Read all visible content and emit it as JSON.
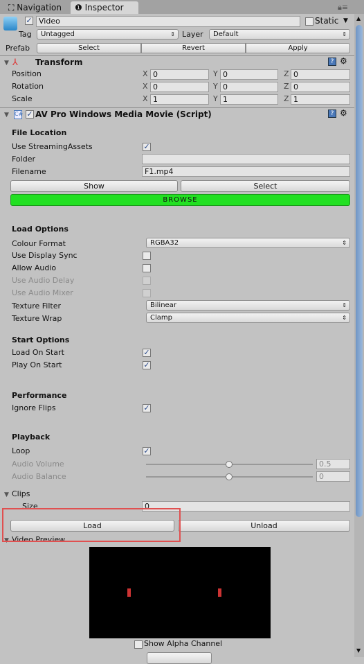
{
  "tabs": [
    {
      "label": "Navigation",
      "icon": "navigation-icon"
    },
    {
      "label": "Inspector",
      "icon": "info-icon"
    }
  ],
  "object": {
    "name": "Video",
    "active": true,
    "static_label": "Static",
    "static": false,
    "tag_label": "Tag",
    "tag": "Untagged",
    "layer_label": "Layer",
    "layer": "Default",
    "prefab_label": "Prefab",
    "prefab_buttons": [
      "Select",
      "Revert",
      "Apply"
    ]
  },
  "transform": {
    "title": "Transform",
    "rows": [
      {
        "label": "Position",
        "x": "0",
        "y": "0",
        "z": "0"
      },
      {
        "label": "Rotation",
        "x": "0",
        "y": "0",
        "z": "0"
      },
      {
        "label": "Scale",
        "x": "1",
        "y": "1",
        "z": "1"
      }
    ],
    "axes": [
      "X",
      "Y",
      "Z"
    ]
  },
  "script": {
    "title": "AV Pro Windows Media Movie (Script)",
    "file_location": "File Location",
    "use_streaming_label": "Use StreamingAssets",
    "folder_label": "Folder",
    "folder": "",
    "filename_label": "Filename",
    "filename": "F1.mp4",
    "show": "Show",
    "select": "Select",
    "browse": "BROWSE",
    "load_options": "Load Options",
    "colour_format_label": "Colour Format",
    "colour_format": "RGBA32",
    "display_sync": "Use Display Sync",
    "allow_audio": "Allow Audio",
    "audio_delay": "Use Audio Delay",
    "audio_mixer": "Use Audio Mixer",
    "texture_filter_label": "Texture Filter",
    "texture_filter": "Bilinear",
    "texture_wrap_label": "Texture Wrap",
    "texture_wrap": "Clamp",
    "start_options": "Start Options",
    "load_on_start": "Load On Start",
    "play_on_start": "Play On Start",
    "performance": "Performance",
    "ignore_flips": "Ignore Flips",
    "playback": "Playback",
    "loop": "Loop",
    "audio_volume_label": "Audio Volume",
    "audio_volume": "0.5",
    "audio_balance_label": "Audio Balance",
    "audio_balance": "0",
    "clips": "Clips",
    "size_label": "Size",
    "size": "0",
    "load": "Load",
    "unload": "Unload",
    "video_preview": "Video Preview",
    "show_alpha": "Show Alpha Channel"
  },
  "colors": {
    "browse": "#22e022",
    "highlight": "#e05050"
  }
}
